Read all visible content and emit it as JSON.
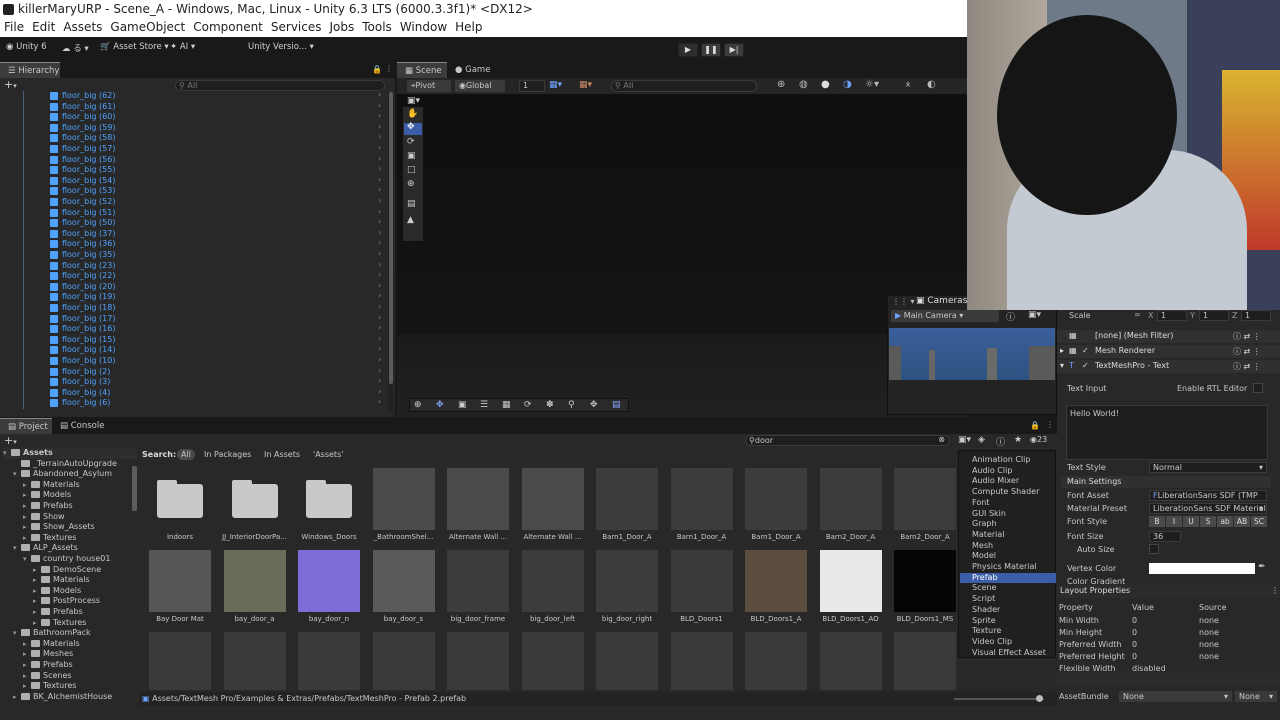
{
  "window": {
    "title": "killerMaryURP - Scene_A - Windows, Mac, Linux - Unity 6.3 LTS (6000.3.3f1)* <DX12>"
  },
  "menu": [
    "File",
    "Edit",
    "Assets",
    "GameObject",
    "Component",
    "Services",
    "Jobs",
    "Tools",
    "Window",
    "Help"
  ],
  "toolbar": {
    "account": "Unity 6",
    "cloud_label": "る",
    "asset_store": "Asset Store",
    "ai": "AI",
    "version_control": "Unity Versio..."
  },
  "hierarchy": {
    "tab": "Hierarchy",
    "search_placeholder": "All",
    "items": [
      "floor_big (62)",
      "floor_big (61)",
      "floor_big (60)",
      "floor_big (59)",
      "floor_big (58)",
      "floor_big (57)",
      "floor_big (56)",
      "floor_big (55)",
      "floor_big (54)",
      "floor_big (53)",
      "floor_big (52)",
      "floor_big (51)",
      "floor_big (50)",
      "floor_big (37)",
      "floor_big (36)",
      "floor_big (35)",
      "floor_big (23)",
      "floor_big (22)",
      "floor_big (20)",
      "floor_big (19)",
      "floor_big (18)",
      "floor_big (17)",
      "floor_big (16)",
      "floor_big (15)",
      "floor_big (14)",
      "floor_big (10)",
      "floor_big (2)",
      "floor_big (3)",
      "floor_big (4)",
      "floor_big (6)"
    ]
  },
  "scene": {
    "tabs": [
      "Scene",
      "Game"
    ],
    "pivot": "Pivot",
    "global": "Global",
    "grid_snap": "1",
    "search_placeholder": "All"
  },
  "cameras": {
    "title": "Cameras",
    "selected": "Main Camera"
  },
  "project": {
    "tabs": [
      "Project",
      "Console"
    ],
    "search_value": "door",
    "search_label": "Search:",
    "scopes": [
      "All",
      "In Packages",
      "In Assets",
      "'Assets'"
    ],
    "hidden_count": "23",
    "path": "Assets/TextMesh Pro/Examples & Extras/Prefabs/TextMeshPro - Prefab 2.prefab",
    "tree": [
      {
        "label": "Assets",
        "depth": 0,
        "open": true
      },
      {
        "label": "_TerrainAutoUpgrade",
        "depth": 1
      },
      {
        "label": "Abandoned_Asylum",
        "depth": 1,
        "open": true
      },
      {
        "label": "Materials",
        "depth": 2
      },
      {
        "label": "Models",
        "depth": 2
      },
      {
        "label": "Prefabs",
        "depth": 2
      },
      {
        "label": "Show",
        "depth": 2
      },
      {
        "label": "Show_Assets",
        "depth": 2
      },
      {
        "label": "Textures",
        "depth": 2
      },
      {
        "label": "ALP_Assets",
        "depth": 1,
        "open": true
      },
      {
        "label": "country house01",
        "depth": 2,
        "open": true
      },
      {
        "label": "DemoScene",
        "depth": 3
      },
      {
        "label": "Materials",
        "depth": 3
      },
      {
        "label": "Models",
        "depth": 3
      },
      {
        "label": "PostProcess",
        "depth": 3
      },
      {
        "label": "Prefabs",
        "depth": 3
      },
      {
        "label": "Textures",
        "depth": 3
      },
      {
        "label": "BathroomPack",
        "depth": 1,
        "open": true
      },
      {
        "label": "Materials",
        "depth": 2
      },
      {
        "label": "Meshes",
        "depth": 2
      },
      {
        "label": "Prefabs",
        "depth": 2
      },
      {
        "label": "Scenes",
        "depth": 2
      },
      {
        "label": "Textures",
        "depth": 2
      },
      {
        "label": "BK_AlchemistHouse",
        "depth": 1
      }
    ],
    "assets_row1": [
      "Indoors",
      "JJ_InteriorDoorPa...",
      "Windows_Doors",
      "_BathroomShel...",
      "Alternate Wall ...",
      "Alternate Wall ...",
      "Barn1_Door_A",
      "Barn1_Door_A",
      "Barn1_Door_A",
      "Barn2_Door_A",
      "Barn2_Door_A"
    ],
    "assets_row2": [
      "Bay Door Mat",
      "bay_door_a",
      "bay_door_n",
      "bay_door_s",
      "big_door_frame",
      "big_door_left",
      "big_door_right",
      "BLD_Doors1",
      "BLD_Doors1_A",
      "BLD_Doors1_AO",
      "BLD_Doors1_MS"
    ]
  },
  "type_menu": {
    "items": [
      "Animation Clip",
      "Audio Clip",
      "Audio Mixer",
      "Compute Shader",
      "Font",
      "GUI Skin",
      "Graph",
      "Material",
      "Mesh",
      "Model",
      "Physics Material",
      "Prefab",
      "Scene",
      "Script",
      "Shader",
      "Sprite",
      "Texture",
      "Video Clip",
      "Visual Effect Asset"
    ],
    "selected": "Prefab"
  },
  "inspector": {
    "scale_label": "Scale",
    "scale": {
      "x": "1",
      "y": "1",
      "z": "1"
    },
    "components": [
      "[none] (Mesh Filter)",
      "Mesh Renderer",
      "TextMeshPro - Text"
    ],
    "text_input_label": "Text Input",
    "rtl_label": "Enable RTL Editor",
    "text_value": "Hello World!",
    "text_style_label": "Text Style",
    "text_style": "Normal",
    "main_settings": "Main Settings",
    "font_asset_label": "Font Asset",
    "font_asset": "LiberationSans SDF (TMP",
    "material_preset_label": "Material Preset",
    "material_preset": "LiberationSans SDF Material",
    "font_style_label": "Font Style",
    "font_style_buttons": [
      "B",
      "I",
      "U",
      "S",
      "ab",
      "AB",
      "SC"
    ],
    "font_size_label": "Font Size",
    "font_size": "36",
    "auto_size_label": "Auto Size",
    "vertex_color_label": "Vertex Color",
    "color_gradient_label": "Color Gradient",
    "layout_title": "Layout Properties",
    "layout_headers": [
      "Property",
      "Value",
      "Source"
    ],
    "layout_rows": [
      [
        "Min Width",
        "0",
        "none"
      ],
      [
        "Min Height",
        "0",
        "none"
      ],
      [
        "Preferred Width",
        "0",
        "none"
      ],
      [
        "Preferred Height",
        "0",
        "none"
      ],
      [
        "Flexible Width",
        "disabled",
        ""
      ]
    ],
    "asset_bundle_label": "AssetBundle",
    "asset_bundle": "None",
    "asset_variant": "None"
  }
}
